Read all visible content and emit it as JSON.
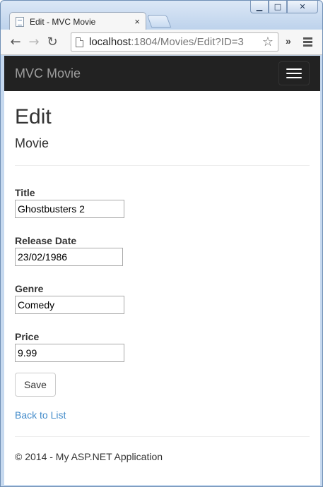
{
  "browser": {
    "tab_title": "Edit - MVC Movie",
    "tab_close": "×",
    "url_host": "localhost",
    "url_path": ":1804/Movies/Edit?ID=3",
    "overflow_chevron": "»"
  },
  "navbar": {
    "brand": "MVC Movie"
  },
  "page": {
    "title": "Edit",
    "subtitle": "Movie"
  },
  "form": {
    "title_label": "Title",
    "title_value": "Ghostbusters 2",
    "release_date_label": "Release Date",
    "release_date_value": "23/02/1986",
    "genre_label": "Genre",
    "genre_value": "Comedy",
    "price_label": "Price",
    "price_value": "9.99",
    "save_label": "Save"
  },
  "links": {
    "back_to_list": "Back to List"
  },
  "footer": {
    "text": "© 2014 - My ASP.NET Application"
  }
}
